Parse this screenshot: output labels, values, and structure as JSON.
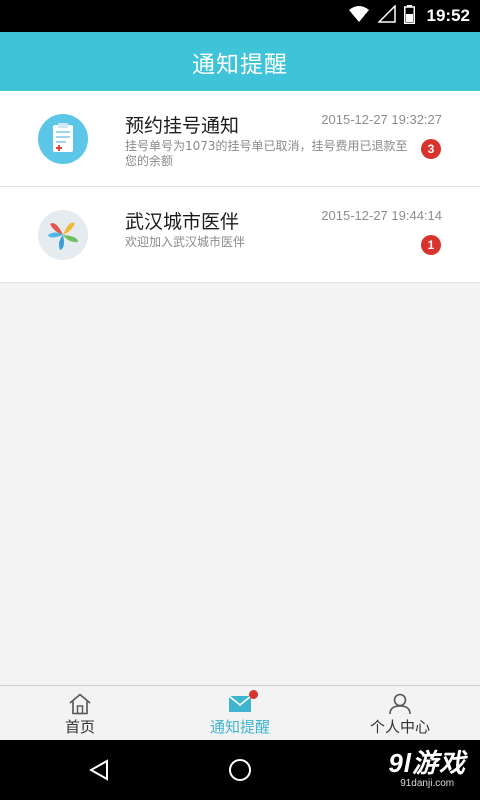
{
  "status_bar": {
    "time": "19:52",
    "icons": [
      "wifi-icon",
      "signal-icon",
      "battery-icon"
    ]
  },
  "header": {
    "title": "通知提醒"
  },
  "notifications": [
    {
      "icon": "clipboard-icon",
      "title": "预约挂号通知",
      "time": "2015-12-27 19:32:27",
      "description": "挂号单号为1073的挂号单已取消，挂号费用已退款至您的余额",
      "badge": "3"
    },
    {
      "icon": "app-logo-icon",
      "title": "武汉城市医伴",
      "time": "2015-12-27 19:44:14",
      "description": "欢迎加入武汉城市医伴",
      "badge": "1"
    }
  ],
  "tabbar": {
    "tabs": [
      {
        "label": "首页",
        "icon": "home-icon",
        "active": false
      },
      {
        "label": "通知提醒",
        "icon": "mail-icon",
        "active": true
      },
      {
        "label": "个人中心",
        "icon": "person-icon",
        "active": false
      }
    ]
  },
  "nav_bar": {
    "buttons": [
      "back-icon",
      "home-circle-icon"
    ]
  },
  "watermark": {
    "main": "9l游戏",
    "sub": "91danji.com"
  },
  "colors": {
    "header": "#3fc3d9",
    "badge": "#d8332c",
    "active_tab": "#3fb4cf",
    "background": "#f4f4f4"
  }
}
